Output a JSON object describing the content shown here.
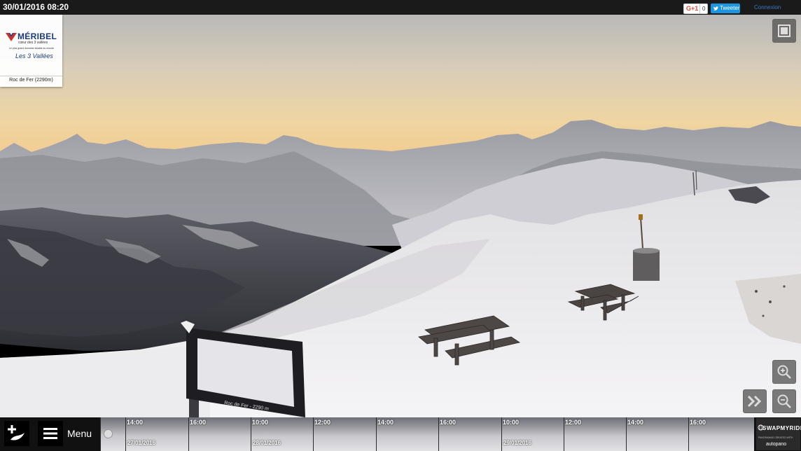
{
  "header": {
    "datetime": "30/01/2016 08:20",
    "gplus_label": "G+1",
    "gplus_count": "0",
    "tweet_label": "Tweeter",
    "login_label": "Connexion"
  },
  "logo": {
    "title": "MÉRIBEL",
    "subtitle": "cœur des 3 vallées",
    "tagline": "Le plus grand domaine skiable du monde",
    "partner": "Les 3 Vallées",
    "location": "Roc de Fer (2290m)"
  },
  "sign": {
    "text": "Roc de Fer - 2290 m"
  },
  "controls": {
    "menu_label": "Menu"
  },
  "timeline": [
    {
      "time": "14:00",
      "date": "27/01/2016"
    },
    {
      "time": "16:00",
      "date": ""
    },
    {
      "time": "10:00",
      "date": "28/01/2016"
    },
    {
      "time": "12:00",
      "date": ""
    },
    {
      "time": "14:00",
      "date": ""
    },
    {
      "time": "16:00",
      "date": ""
    },
    {
      "time": "10:00",
      "date": "29/01/2016"
    },
    {
      "time": "12:00",
      "date": ""
    },
    {
      "time": "14:00",
      "date": ""
    },
    {
      "time": "16:00",
      "date": ""
    }
  ],
  "brand": {
    "name": "SWAPMYRIDE",
    "tagline": "PANORAMAS CREATED WITH",
    "engine": "autopano"
  },
  "colors": {
    "tweet": "#1b95e0",
    "login": "#3a79c8",
    "logo_blue": "#1a3a75",
    "logo_red": "#d0302a"
  }
}
